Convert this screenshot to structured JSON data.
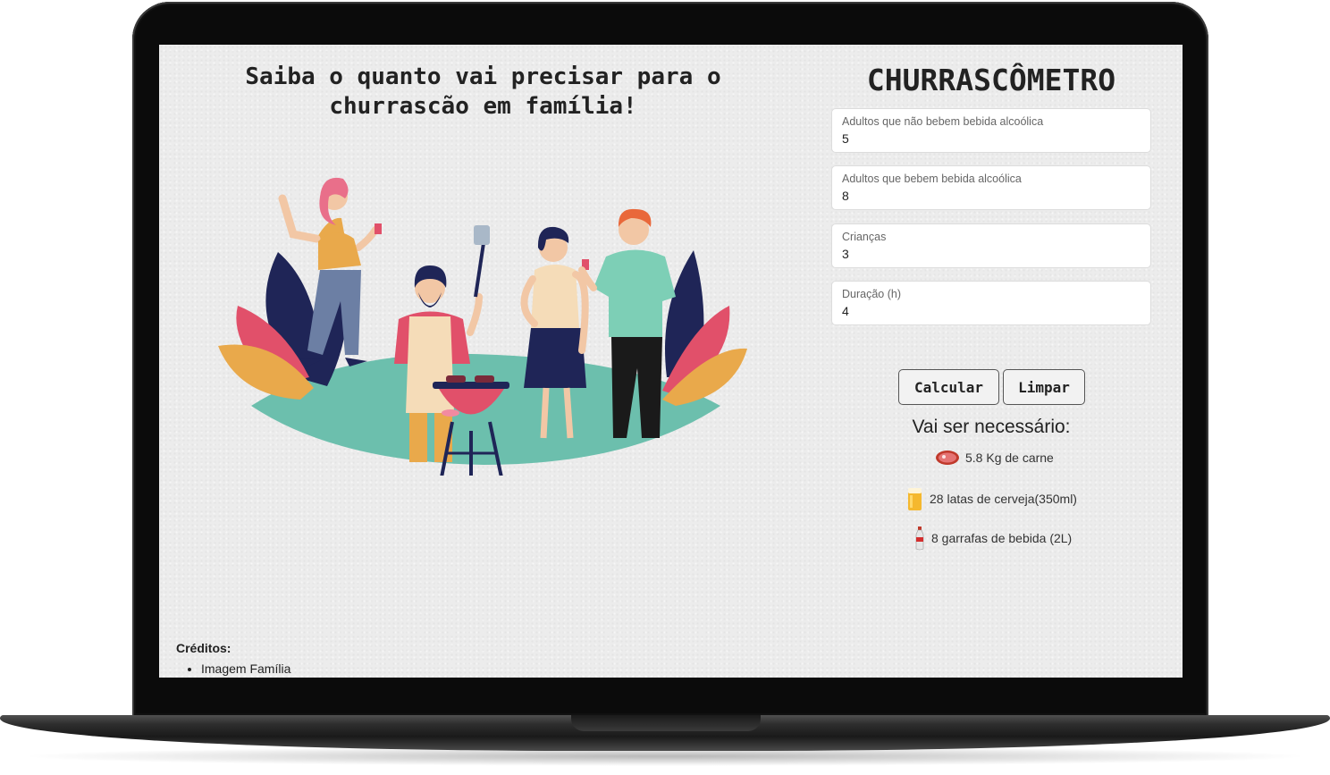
{
  "headline": {
    "line1": "Saiba o quanto vai precisar para o",
    "line2": "churrascão em família!"
  },
  "illustration": {
    "name": "family-barbecue-illustration"
  },
  "app": {
    "title": "CHURRASCÔMETRO"
  },
  "form": {
    "fields": [
      {
        "label": "Adultos que não bebem bebida alcoólica",
        "value": "5"
      },
      {
        "label": "Adultos que bebem bebida alcoólica",
        "value": "8"
      },
      {
        "label": "Crianças",
        "value": "3"
      },
      {
        "label": "Duração (h)",
        "value": "4"
      }
    ],
    "calculate_label": "Calcular",
    "clear_label": "Limpar"
  },
  "results": {
    "title": "Vai ser necessário:",
    "items": [
      {
        "icon": "meat-icon",
        "text": "5.8 Kg de carne"
      },
      {
        "icon": "beer-icon",
        "text": "28 latas de cerveja(350ml)"
      },
      {
        "icon": "bottle-icon",
        "text": "8 garrafas de bebida (2L)"
      }
    ]
  },
  "credits": {
    "title": "Créditos:",
    "items": [
      "Imagem Família"
    ]
  },
  "colors": {
    "lawn": "#6cbfad",
    "grill": "#e1506a",
    "screen_bg": "#ececec"
  }
}
